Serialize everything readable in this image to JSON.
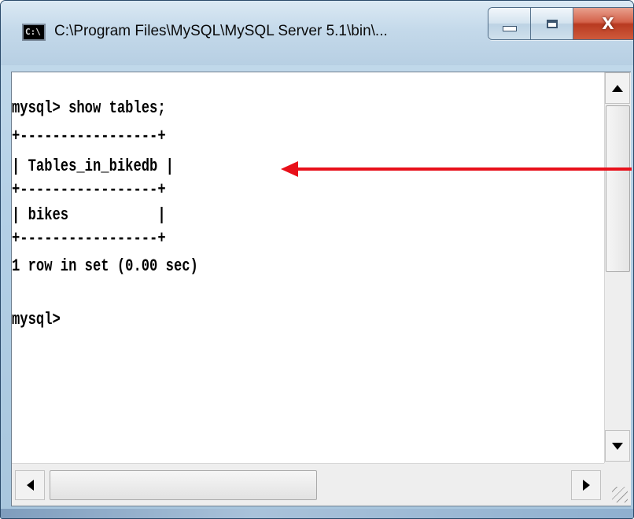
{
  "window": {
    "title": "C:\\Program Files\\MySQL\\MySQL Server 5.1\\bin\\...",
    "icon": "cmd-icon",
    "icon_label": "C:\\",
    "controls": {
      "minimize": "minimize-icon",
      "maximize": "maximize-icon",
      "close": "X"
    }
  },
  "console": {
    "lines": [
      "mysql> show tables;",
      "+-----------------+",
      "| Tables_in_bikedb |",
      "+-----------------+",
      "| bikes           |",
      "+-----------------+",
      "1 row in set (0.00 sec)",
      "mysql>"
    ]
  },
  "annotation": {
    "type": "arrow",
    "color": "#e8101a",
    "points_to": "mysql> show tables;"
  },
  "colors": {
    "console_bg": "#ffffff",
    "console_text": "#000000",
    "arrow": "#e8101a"
  }
}
